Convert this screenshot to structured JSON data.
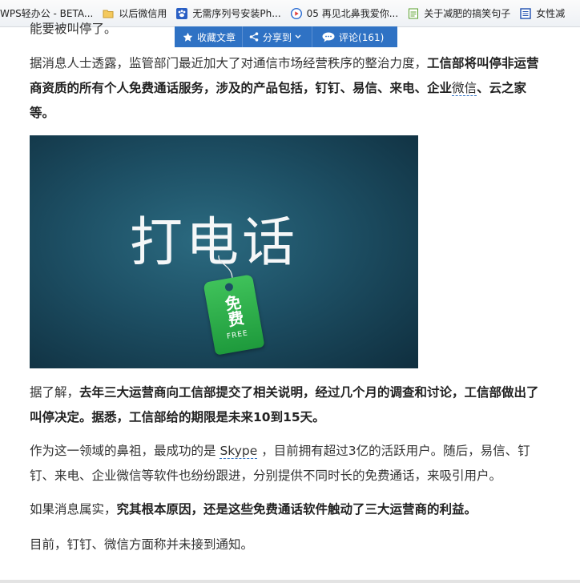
{
  "bookmarks": [
    {
      "icon": "wps-icon",
      "label": "WPS轻办公 - BETA..."
    },
    {
      "icon": "folder-icon",
      "label": "以后微信用"
    },
    {
      "icon": "paw-icon",
      "label": "无需序列号安装Ph..."
    },
    {
      "icon": "play-icon",
      "label": "05 再见北鼻我爱你..."
    },
    {
      "icon": "page-icon",
      "label": "关于减肥的搞笑句子"
    },
    {
      "icon": "blue-page-icon",
      "label": "女性减"
    }
  ],
  "share_bar": {
    "favorite": "收藏文章",
    "share": "分享到",
    "comments": "评论(161)"
  },
  "article": {
    "p0": "能要被叫停了。",
    "p1_plain": "据消息人士透露，监管部门最近加大了对通信市场经营秩序的整治力度，",
    "p1_bold1": "工信部将叫停非运营商资质的所有个人免费通话服务，涉及的产品包括，钉钉、易信、来电、企业",
    "p1_kw": "微信",
    "p1_bold2": "、云之家等。",
    "image": {
      "title": "打电话",
      "tag_cn": "免费",
      "tag_en": "FREE"
    },
    "p2_plain": "据了解，",
    "p2_bold": "去年三大运营商向工信部提交了相关说明，经过几个月的调查和讨论，工信部做出了叫停决定。据悉，工信部给的期限是未来10到15天。",
    "p3_a": "作为这一领域的鼻祖，最成功的是",
    "p3_kw": "Skype",
    "p3_b": "，目前拥有超过3亿的活跃用户。随后，易信、钉钉、来电、企业微信等软件也纷纷跟进，分别提供不同时长的免费通话，来吸引用户。",
    "p4_plain": "如果消息属实，",
    "p4_bold": "究其根本原因，还是这些免费通话软件触动了三大运营商的利益。",
    "p5": "目前，钉钉、微信方面称并未接到通知。"
  }
}
